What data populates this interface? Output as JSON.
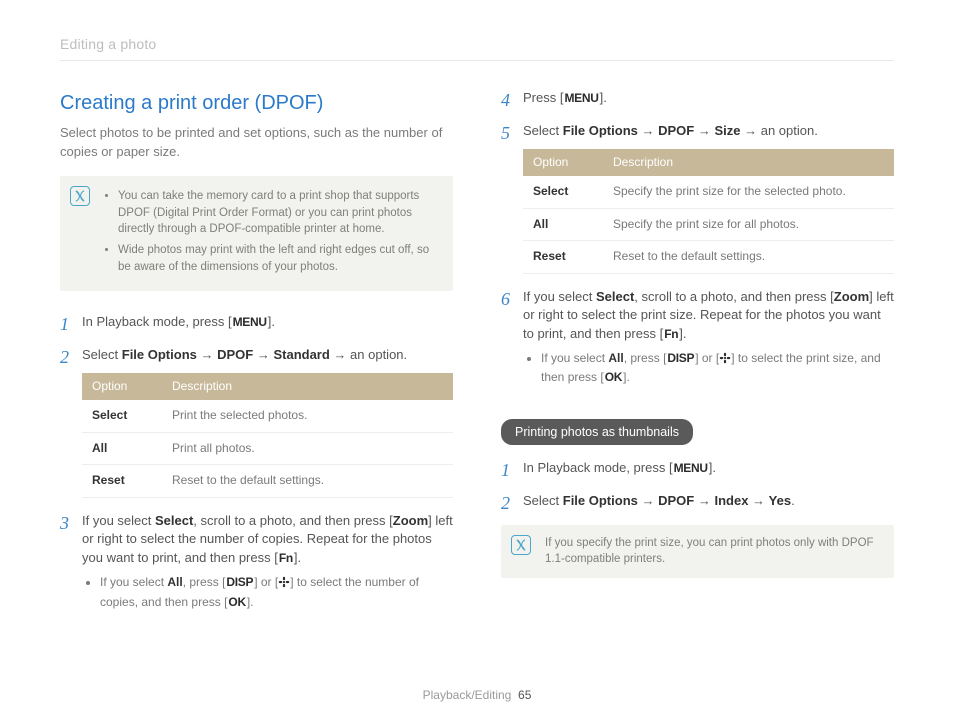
{
  "header": {
    "crumb": "Editing a photo"
  },
  "left": {
    "h2": "Creating a print order (DPOF)",
    "intro": "Select photos to be printed and set options, such as the number of copies or paper size.",
    "note": {
      "items": [
        "You can take the memory card to a print shop that supports DPOF (Digital Print Order Format) or you can print photos directly through a DPOF-compatible printer at home.",
        "Wide photos may print with the left and right edges cut off, so be aware of the dimensions of your photos."
      ]
    },
    "step1_a": "In Playback mode, press [",
    "step1_b": "].",
    "step2_a": "Select ",
    "step2_b": "File Options",
    "step2_c": " → ",
    "step2_d": "DPOF",
    "step2_e": " → ",
    "step2_f": "Standard",
    "step2_g": " → an option.",
    "table": {
      "h1": "Option",
      "h2": "Description",
      "rows": [
        {
          "opt": "Select",
          "desc": "Print the selected photos."
        },
        {
          "opt": "All",
          "desc": "Print all photos."
        },
        {
          "opt": "Reset",
          "desc": "Reset to the default settings."
        }
      ]
    },
    "step3_a": "If you select ",
    "step3_b": "Select",
    "step3_c": ", scroll to a photo, and then press [",
    "step3_d": "Zoom",
    "step3_e": "] left or right to select the number of copies. Repeat for the photos you want to print, and then press [",
    "step3_f": "].",
    "step3_sub_a": "If you select ",
    "step3_sub_b": "All",
    "step3_sub_c": ", press [",
    "step3_sub_d": "] or [",
    "step3_sub_e": "] to select the number of copies, and then press [",
    "step3_sub_f": "]."
  },
  "right": {
    "step4_a": "Press [",
    "step4_b": "].",
    "step5_a": "Select ",
    "step5_b": "File Options",
    "step5_c": " → ",
    "step5_d": "DPOF",
    "step5_e": " → ",
    "step5_f": "Size",
    "step5_g": " → an option.",
    "table": {
      "h1": "Option",
      "h2": "Description",
      "rows": [
        {
          "opt": "Select",
          "desc": "Specify the print size for the selected photo."
        },
        {
          "opt": "All",
          "desc": "Specify the print size for all photos."
        },
        {
          "opt": "Reset",
          "desc": "Reset to the default settings."
        }
      ]
    },
    "step6_a": "If you select ",
    "step6_b": "Select",
    "step6_c": ", scroll to a photo, and then press [",
    "step6_d": "Zoom",
    "step6_e": "] left or right to select the print size. Repeat for the photos you want to print, and then press [",
    "step6_f": "].",
    "step6_sub_a": "If you select ",
    "step6_sub_b": "All",
    "step6_sub_c": ", press [",
    "step6_sub_d": "] or [",
    "step6_sub_e": "] to select the print size, and then press [",
    "step6_sub_f": "].",
    "pill": "Printing photos as thumbnails",
    "tstep1_a": "In Playback mode, press [",
    "tstep1_b": "].",
    "tstep2_a": "Select ",
    "tstep2_b": "File Options",
    "tstep2_c": " → ",
    "tstep2_d": "DPOF",
    "tstep2_e": " → ",
    "tstep2_f": "Index",
    "tstep2_g": " → ",
    "tstep2_h": "Yes",
    "tstep2_i": ".",
    "note2": "If you specify the print size, you can print photos only with DPOF 1.1-compatible printers."
  },
  "keys": {
    "menu": "MENU",
    "fn": "Fn",
    "disp": "DISP",
    "ok": "OK"
  },
  "footer": {
    "section": "Playback/Editing",
    "page": "65"
  }
}
